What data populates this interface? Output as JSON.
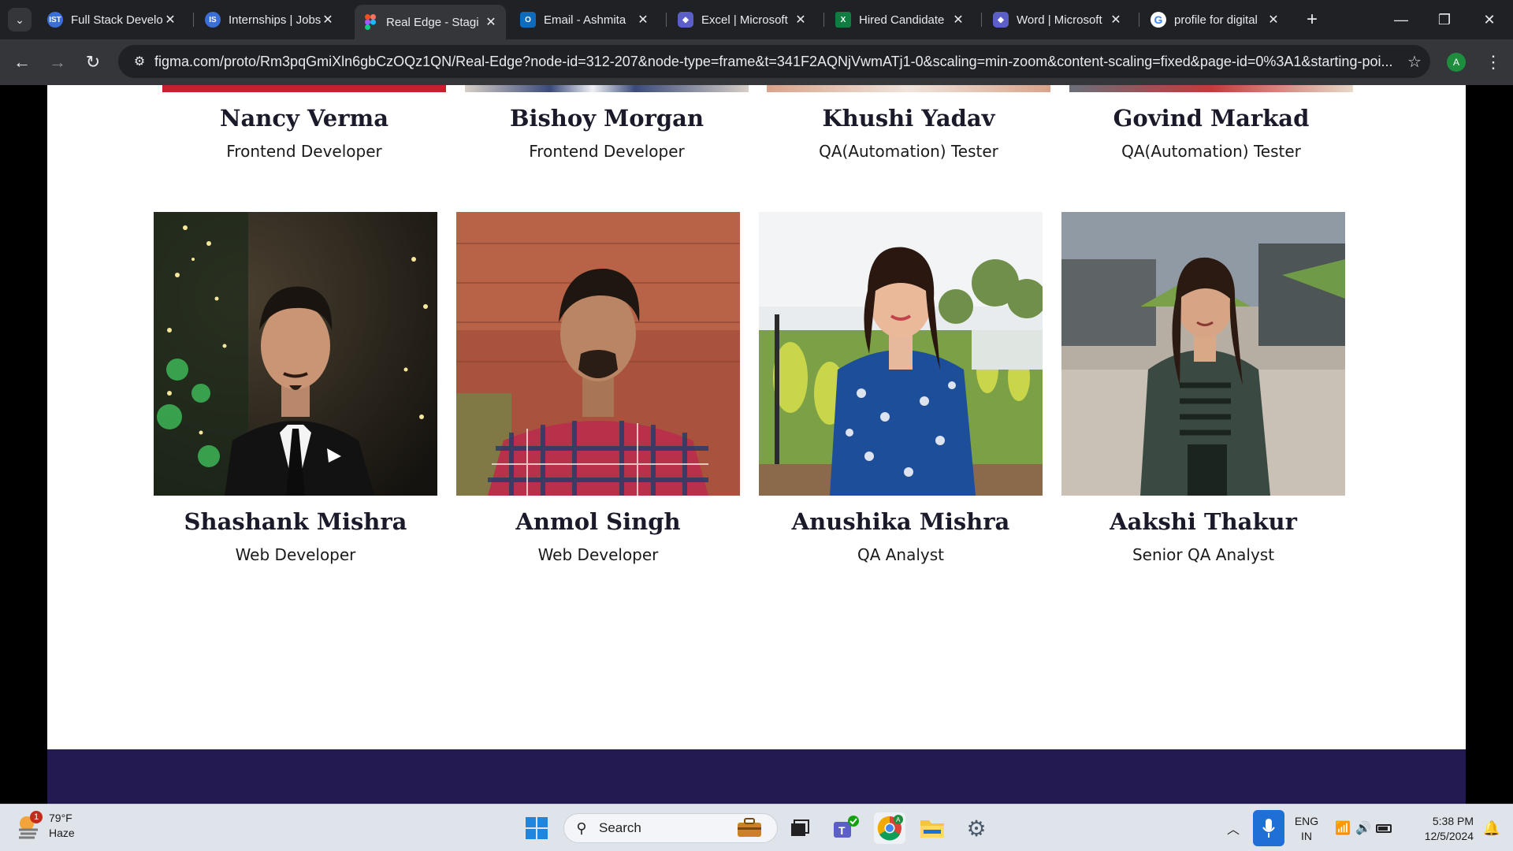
{
  "browser": {
    "tabs": [
      {
        "title": "Full Stack Develo",
        "favicon": "IST",
        "favicon_color": "#3b6fd8",
        "active": false
      },
      {
        "title": "Internships | Jobs",
        "favicon": "IS",
        "favicon_color": "#3b6fd8",
        "active": false
      },
      {
        "title": "Real Edge - Stagi",
        "favicon": "figma-icon",
        "favicon_color": "#f24e1e",
        "active": true
      },
      {
        "title": "Email - Ashmita",
        "favicon": "outlook-icon",
        "favicon_color": "#0f6cbd",
        "active": false
      },
      {
        "title": "Excel | Microsoft",
        "favicon": "copilot-icon",
        "favicon_color": "#5b5fc7",
        "active": false
      },
      {
        "title": "Hired Candidate",
        "favicon": "excel-icon",
        "favicon_color": "#107c41",
        "active": false
      },
      {
        "title": "Word | Microsoft",
        "favicon": "copilot-icon",
        "favicon_color": "#5b5fc7",
        "active": false
      },
      {
        "title": "profile for digital",
        "favicon": "google-icon",
        "favicon_color": "#4285f4",
        "active": false
      }
    ],
    "url": "figma.com/proto/Rm3pqGmiXln6gbCzOQz1QN/Real-Edge?node-id=312-207&node-type=frame&t=341F2AQNjVwmATj1-0&scaling=min-zoom&content-scaling=fixed&page-id=0%3A1&starting-poi...",
    "profile_initial": "A"
  },
  "team": {
    "top_row": [
      {
        "name": "Nancy Verma",
        "role": "Frontend Developer",
        "strip_color": "#c6202e"
      },
      {
        "name": "Bishoy Morgan",
        "role": "Frontend Developer",
        "strip_color": "#3a4a7a"
      },
      {
        "name": "Khushi Yadav",
        "role": "QA(Automation) Tester",
        "strip_color": "#d9a38a"
      },
      {
        "name": "Govind Markad",
        "role": "QA(Automation) Tester",
        "strip_color": "#c43a3a"
      }
    ],
    "bottom_row": [
      {
        "name": "Shashank Mishra",
        "role": "Web Developer",
        "photo": "man-in-black-suit-photo"
      },
      {
        "name": "Anmol Singh",
        "role": "Web Developer",
        "photo": "man-in-plaid-shirt-photo"
      },
      {
        "name": "Anushika Mishra",
        "role": "QA Analyst",
        "photo": "woman-in-blue-kurta-photo"
      },
      {
        "name": "Aakshi Thakur",
        "role": "Senior QA Analyst",
        "photo": "woman-in-cardigan-photo"
      }
    ]
  },
  "taskbar": {
    "weather_badge": "1",
    "temperature": "79°F",
    "condition": "Haze",
    "search_label": "Search",
    "language": "ENG",
    "region": "IN",
    "time": "5:38 PM",
    "date": "12/5/2024"
  },
  "colors": {
    "footer_band": "#231a52",
    "page_bg": "#ffffff",
    "chrome_dark": "#202124"
  }
}
